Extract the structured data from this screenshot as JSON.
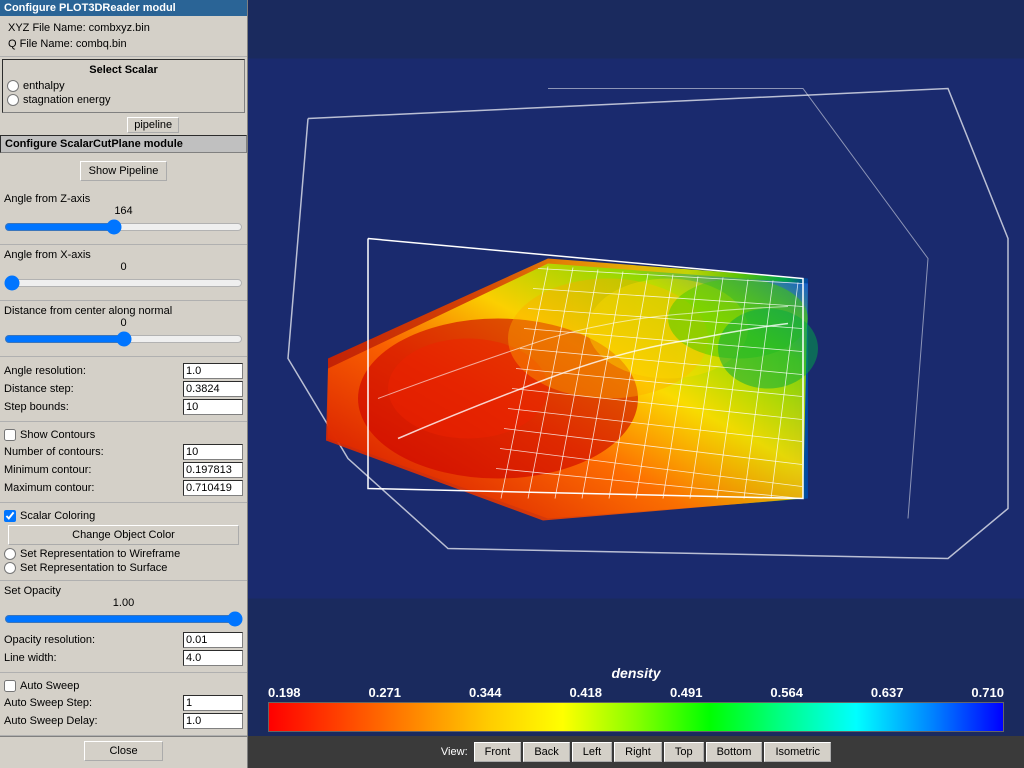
{
  "window": {
    "title": "Configure PLOT3DReader modul"
  },
  "leftPanel": {
    "plot3d": {
      "title": "Configure PLOT3DReader modul",
      "xyz_file_label": "XYZ File Name: combxyz.bin",
      "q_file_label": "Q File Name: combq.bin"
    },
    "selectScalar": {
      "title": "Select Scalar",
      "options": [
        "enthalpy",
        "stagnation energy"
      ]
    },
    "cutPlane": {
      "title": "Configure ScalarCutPlane module",
      "showPipelineLabel": "Show Pipeline",
      "angleFromZAxis": {
        "label": "Angle from Z-axis",
        "value": "164"
      },
      "angleFromXAxis": {
        "label": "Angle from X-axis",
        "value": "0"
      },
      "distanceFromCenter": {
        "label": "Distance from center along normal",
        "value": "0"
      },
      "angleResolution": {
        "label": "Angle resolution:",
        "value": "1.0"
      },
      "distanceStep": {
        "label": "Distance step:",
        "value": "0.3824"
      },
      "stepBounds": {
        "label": "Step bounds:",
        "value": "10"
      },
      "showContours": {
        "label": "Show Contours",
        "checked": false
      },
      "numberOfContours": {
        "label": "Number of contours:",
        "value": "10"
      },
      "minimumContour": {
        "label": "Minimum contour:",
        "value": "0.197813"
      },
      "maximumContour": {
        "label": "Maximum contour:",
        "value": "0.710419"
      }
    },
    "scalarColoring": {
      "title": "Scalar Coloring",
      "checked": true,
      "changeObjectColorLabel": "Change Object Color",
      "wireframeLabel": "Set Representation to Wireframe",
      "surfaceLabel": "Set Representation to Surface",
      "setOpacityLabel": "Set Opacity",
      "opacityValue": "1.00",
      "opacityResolutionLabel": "Opacity resolution:",
      "opacityResolutionValue": "0.01",
      "lineWidthLabel": "Line width:",
      "lineWidthValue": "4.0",
      "autoSweepLabel": "Auto Sweep",
      "autoSweepStepLabel": "Auto Sweep Step:",
      "autoSweepStepValue": "1",
      "autoSweepDelayLabel": "Auto Sweep Delay:",
      "autoSweepDelayValue": "1.0",
      "closeLabel": "Close"
    }
  },
  "visualization": {
    "colorbar": {
      "title": "density",
      "values": [
        "0.198",
        "0.271",
        "0.344",
        "0.418",
        "0.491",
        "0.564",
        "0.637",
        "0.710"
      ]
    },
    "viewButtons": {
      "viewLabel": "View:",
      "buttons": [
        "Front",
        "Back",
        "Left",
        "Right",
        "Top",
        "Bottom",
        "Isometric"
      ]
    }
  }
}
